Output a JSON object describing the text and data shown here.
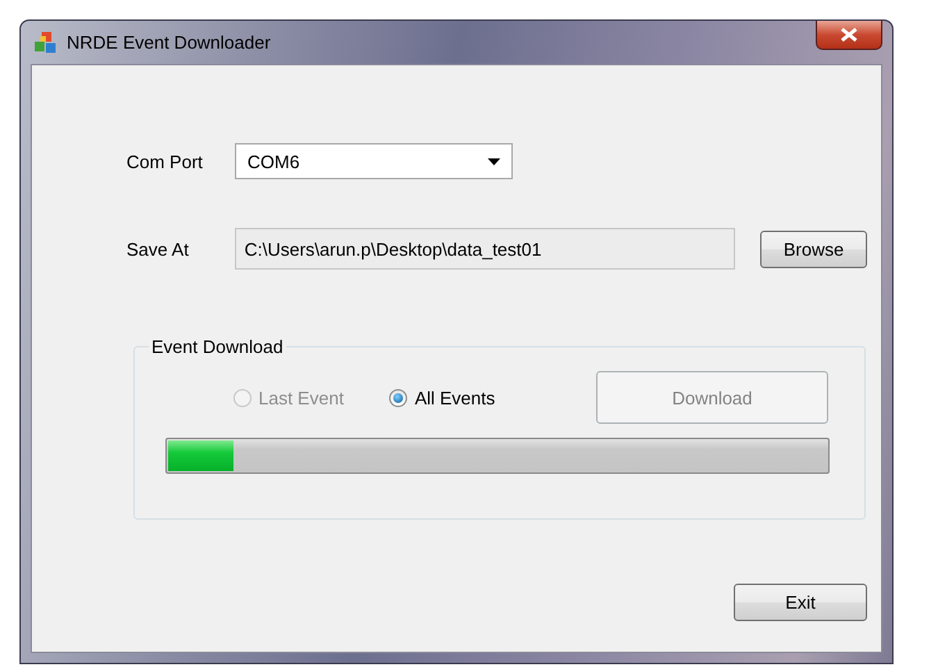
{
  "window": {
    "title": "NRDE Event Downloader"
  },
  "com_port": {
    "label": "Com Port",
    "value": "COM6"
  },
  "save_at": {
    "label": "Save At",
    "value": "C:\\Users\\arun.p\\Desktop\\data_test01",
    "button": "Browse"
  },
  "event_download": {
    "title": "Event Download",
    "options": [
      {
        "label": "Last Event",
        "selected": false,
        "disabled": true
      },
      {
        "label": "All Events",
        "selected": true,
        "disabled": false
      }
    ],
    "download_button": {
      "label": "Download",
      "disabled": true
    },
    "progress": {
      "level": 0.1
    }
  },
  "exit_button": {
    "label": "Exit"
  }
}
